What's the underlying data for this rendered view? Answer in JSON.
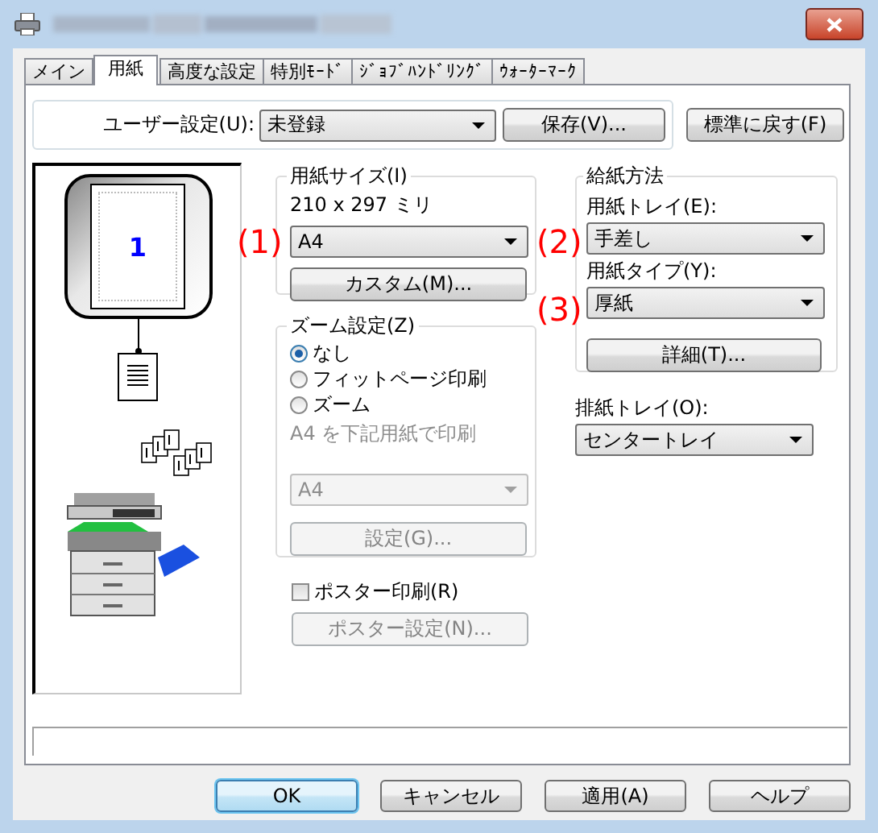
{
  "tabs": [
    {
      "label": "メイン",
      "selected": false
    },
    {
      "label": "用紙",
      "selected": true
    },
    {
      "label": "高度な設定",
      "selected": false
    },
    {
      "label": "特別ﾓｰﾄﾞ",
      "selected": false
    },
    {
      "label": "ｼﾞｮﾌﾞﾊﾝﾄﾞﾘﾝｸﾞ",
      "selected": false
    },
    {
      "label": "ｳｫｰﾀｰﾏｰｸ",
      "selected": false
    }
  ],
  "user_setting": {
    "label": "ユーザー設定(U):",
    "value": "未登録",
    "save_button": "保存(V)...",
    "reset_button": "標準に戻す(F)"
  },
  "preview": {
    "page_number": "1"
  },
  "paper_size": {
    "title": "用紙サイズ(I)",
    "dimensions": "210 x 297 ミリ",
    "value": "A4",
    "custom_button": "カスタム(M)..."
  },
  "zoom": {
    "title": "ズーム設定(Z)",
    "options": [
      {
        "label": "なし",
        "selected": true
      },
      {
        "label": "フィットページ印刷",
        "selected": false
      },
      {
        "label": "ズーム",
        "selected": false
      }
    ],
    "note": "A4 を下記用紙で印刷",
    "note_disabled": true,
    "target_value": "A4",
    "target_disabled": true,
    "settings_button": "設定(G)...",
    "settings_disabled": true
  },
  "poster": {
    "label": "ポスター印刷(R)",
    "checked": false,
    "button": "ポスター設定(N)...",
    "button_disabled": true
  },
  "paper_source": {
    "title": "給紙方法",
    "tray_label": "用紙トレイ(E):",
    "tray_value": "手差し",
    "type_label": "用紙タイプ(Y):",
    "type_value": "厚紙",
    "details_button": "詳細(T)..."
  },
  "output_tray": {
    "label": "排紙トレイ(O):",
    "value": "センタートレイ"
  },
  "annotations": [
    "(1)",
    "(2)",
    "(3)"
  ],
  "buttons": [
    {
      "label": "OK",
      "default": true
    },
    {
      "label": "キャンセル",
      "default": false
    },
    {
      "label": "適用(A)",
      "default": false
    },
    {
      "label": "ヘルプ",
      "default": false
    }
  ]
}
